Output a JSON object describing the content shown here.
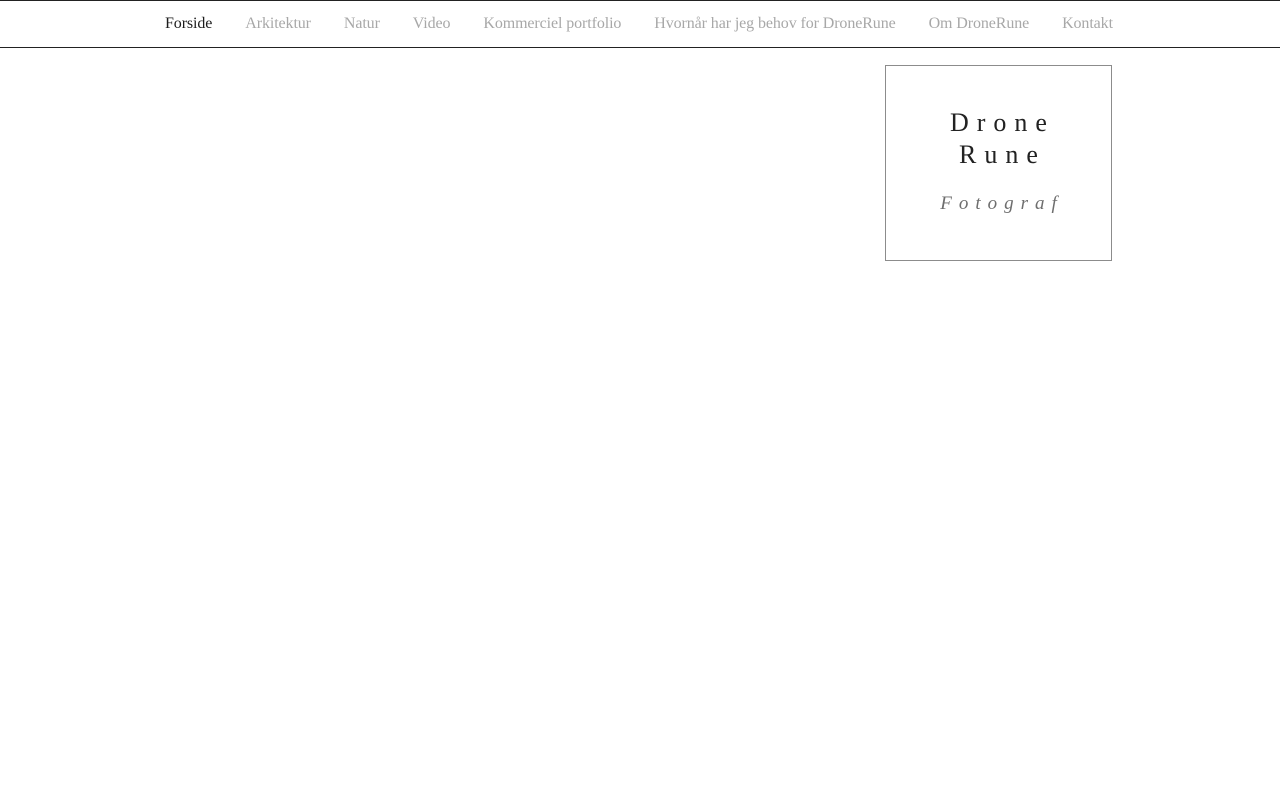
{
  "nav": {
    "items": [
      {
        "label": "Forside",
        "active": true
      },
      {
        "label": "Arkitektur",
        "active": false
      },
      {
        "label": "Natur",
        "active": false
      },
      {
        "label": "Video",
        "active": false
      },
      {
        "label": "Kommerciel portfolio",
        "active": false
      },
      {
        "label": "Hvornår har jeg behov for DroneRune",
        "active": false
      },
      {
        "label": "Om DroneRune",
        "active": false
      },
      {
        "label": "Kontakt",
        "active": false
      }
    ]
  },
  "logo": {
    "line1": "Drone",
    "line2": "Rune",
    "subtitle": "Fotograf"
  },
  "colors": {
    "active_nav": "#1c1c1c",
    "inactive_nav": "#a8a8a8",
    "border": "#222222",
    "logo_border": "#8c8c8c",
    "subtitle": "#6e6e6e"
  }
}
